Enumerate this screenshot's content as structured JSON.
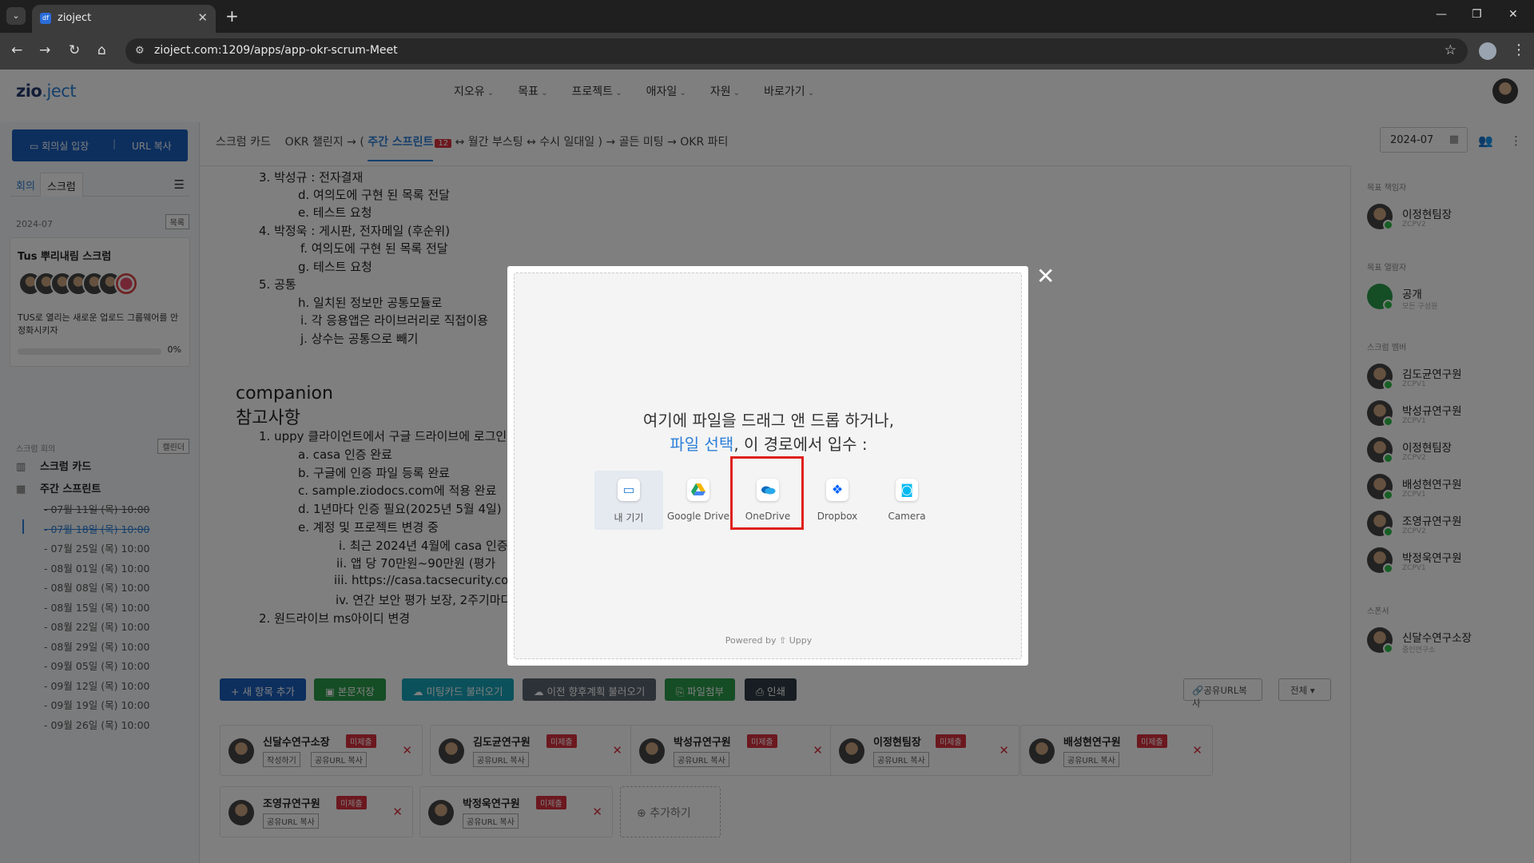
{
  "browser": {
    "tab_title": "zioject",
    "url": "zioject.com:1209/apps/app-okr-scrum-Meet"
  },
  "app": {
    "logo_main": "zio",
    "logo_accent": ".ject",
    "nav": [
      "지오유",
      "목표",
      "프로젝트",
      "애자일",
      "자원",
      "바로가기"
    ]
  },
  "sidebar": {
    "join_label": "회의실 입장",
    "url_copy_label": "URL 복사",
    "tab_meeting": "회의",
    "tab_scrum": "스크럼",
    "month": "2024-07",
    "list_btn": "목록",
    "card_title": "Tus 뿌리내림 스크럼",
    "card_desc": "TUS로 열리는 새로운 업로드 그룹웨어를 안정화시키자",
    "card_progress": "0%",
    "section_label": "스크럼 회의",
    "calendar_btn": "캘린더",
    "item_card": "스크럼 카드",
    "item_sprint": "주간 스프린트",
    "dates": [
      "- 07월 11일 (목) 10:00",
      "- 07월 18일 (목) 10:00",
      "- 07월 25일 (목) 10:00",
      "- 08월 01일 (목) 10:00",
      "- 08월 08일 (목) 10:00",
      "- 08월 15일 (목) 10:00",
      "- 08월 22일 (목) 10:00",
      "- 08월 29일 (목) 10:00",
      "- 09월 05일 (목) 10:00",
      "- 09월 12일 (목) 10:00",
      "- 09월 19일 (목) 10:00",
      "- 09월 26일 (목) 10:00"
    ]
  },
  "breadcrumb": {
    "a": "스크럼 카드",
    "b": "OKR 챌린지 → (",
    "current": "주간 스프린트",
    "badge": "12",
    "c": "↔ 월간 부스팅 ↔ 수시 일대일 ) → 골든 미팅 → OKR 파티"
  },
  "header_date": "2024-07",
  "doc": {
    "lines": [
      "3. 박성규 : 전자결재",
      "d. 여의도에 구현 된 목록 전달",
      "e. 테스트 요청",
      "4. 박정욱 : 게시판, 전자메일 (후순위)",
      "f. 여의도에 구현 된 목록 전달",
      "g. 테스트 요청",
      "5. 공통",
      "h. 일치된 정보만 공통모듈로",
      "i. 각 응용앱은 라이브러리로 직접이용",
      "j. 상수는 공통으로 빼기",
      "1. uppy 클라이언트에서 구글 드라이브에 로그인",
      "a. casa 인증 완료",
      "b. 구글에 인증 파일 등록 완료",
      "c. sample.ziodocs.com에 적용 완료",
      "d. 1년마다 인증 필요(2025년 5월 4일)",
      "e. 계정 및 프로젝트 변경 중",
      "i. 최근 2024년 4월에 casa 인증",
      "ii. 앱 당 70만원~90만원 (평가",
      "iii. https://casa.tacsecurity.com",
      "iv. 연간 보안 평가 보장, 2주기마다",
      "2. 원드라이브 ms아이디 변경"
    ],
    "heading": "companion 참고사항"
  },
  "actions": {
    "new_item": "+ 새 항목 추가",
    "save": "본문저장",
    "load_card": "미팅카드 불러오기",
    "load_prev": "이전 향후계획 불러오기",
    "attach": "파일첨부",
    "print": "인쇄",
    "share_url": "공유URL복사",
    "all": "전체"
  },
  "participants": [
    {
      "name": "신달수연구소장",
      "badge": "미제출",
      "btn1": "작성하기",
      "btn2": "공유URL 복사"
    },
    {
      "name": "김도균연구원",
      "badge": "미제출",
      "btn1": "공유URL 복사"
    },
    {
      "name": "박성규연구원",
      "badge": "미제출",
      "btn1": "공유URL 복사"
    },
    {
      "name": "이정현팀장",
      "badge": "미제출",
      "btn1": "공유URL 복사"
    },
    {
      "name": "배성현연구원",
      "badge": "미제출",
      "btn1": "공유URL 복사"
    },
    {
      "name": "조영규연구원",
      "badge": "미제출",
      "btn1": "공유URL 복사"
    },
    {
      "name": "박정욱연구원",
      "badge": "미제출",
      "btn1": "공유URL 복사"
    }
  ],
  "add_participant": "추가하기",
  "right": {
    "owner_label": "목표 책임자",
    "owner": {
      "name": "이정현팀장",
      "sub": "ZCPV2"
    },
    "visibility_label": "목표 열람자",
    "visibility": {
      "name": "공개",
      "sub": "모든 구성원"
    },
    "members_label": "스크럼 멤버",
    "members": [
      {
        "name": "김도균연구원",
        "sub": "ZCPV1"
      },
      {
        "name": "박성규연구원",
        "sub": "ZCPV1"
      },
      {
        "name": "이정현팀장",
        "sub": "ZCPV2"
      },
      {
        "name": "배성현연구원",
        "sub": "ZCPV1"
      },
      {
        "name": "조영규연구원",
        "sub": "ZCPV2"
      },
      {
        "name": "박정욱연구원",
        "sub": "ZCPV1"
      }
    ],
    "sponsor_label": "스폰서",
    "sponsor": {
      "name": "신달수연구소장",
      "sub": "중인연구소"
    }
  },
  "modal": {
    "line1": "여기에 파일을 드래그 앤 드롭 하거나,",
    "line2_link": "파일 선택",
    "line2_rest": ", 이 경로에서 입수 :",
    "sources": [
      {
        "label": "내 기기",
        "icon": "folder-icon"
      },
      {
        "label": "Google Drive",
        "icon": "google-drive-icon"
      },
      {
        "label": "OneDrive",
        "icon": "onedrive-icon"
      },
      {
        "label": "Dropbox",
        "icon": "dropbox-icon"
      },
      {
        "label": "Camera",
        "icon": "camera-icon"
      }
    ],
    "powered": "Powered by ⇧ Uppy"
  }
}
